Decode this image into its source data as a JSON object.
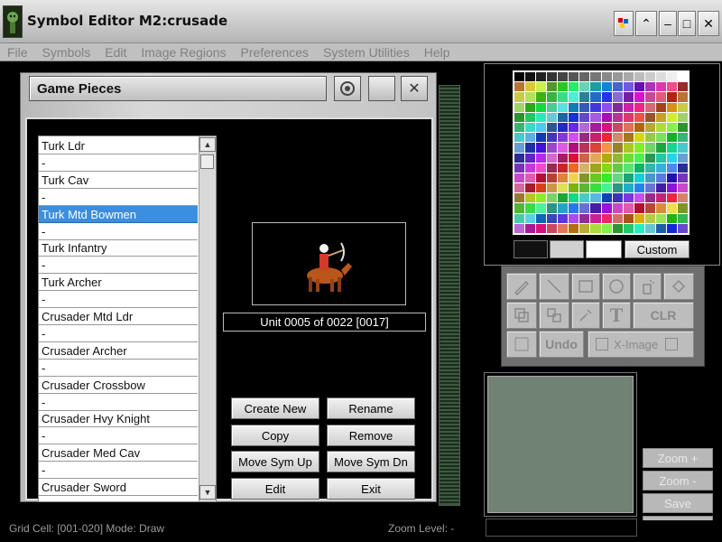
{
  "window": {
    "title": "Symbol Editor M2:crusade"
  },
  "window_controls": {
    "minimize": "–",
    "maximize": "□",
    "close": "✕",
    "up": "⌃"
  },
  "menu": [
    "File",
    "Symbols",
    "Edit",
    "Image Regions",
    "Preferences",
    "System Utilities",
    "Help"
  ],
  "game_pieces": {
    "title": "Game Pieces",
    "items": [
      "Turk Ldr",
      "-",
      "Turk Cav",
      "-",
      "Turk Mtd Bowmen",
      "-",
      "Turk Infantry",
      "-",
      "Turk Archer",
      "-",
      "Crusader Mtd Ldr",
      "-",
      "Crusader Archer",
      "-",
      "Crusader Crossbow",
      "-",
      "Crusader Hvy Knight",
      "-",
      "Crusader Med Cav",
      "-",
      "Crusader Sword"
    ],
    "selected_index": 4,
    "unit_label": "Unit 0005 of 0022 [0017]",
    "buttons": {
      "create_new": "Create New",
      "rename": "Rename",
      "copy": "Copy",
      "remove": "Remove",
      "move_up": "Move Sym Up",
      "move_dn": "Move Sym Dn",
      "edit": "Edit",
      "exit": "Exit"
    }
  },
  "palette": {
    "custom_label": "Custom",
    "slots": [
      "#111111",
      "#d0d0d0",
      "#ffffff"
    ]
  },
  "tools": {
    "clr": "CLR",
    "undo": "Undo",
    "ximage": "X-Image"
  },
  "zoom": {
    "zoom_in": "Zoom +",
    "zoom_out": "Zoom -",
    "save": "Save",
    "next": "Next"
  },
  "status": {
    "left": "Grid Cell: [001-020]  Mode: Draw",
    "right": "Zoom Level: -"
  }
}
